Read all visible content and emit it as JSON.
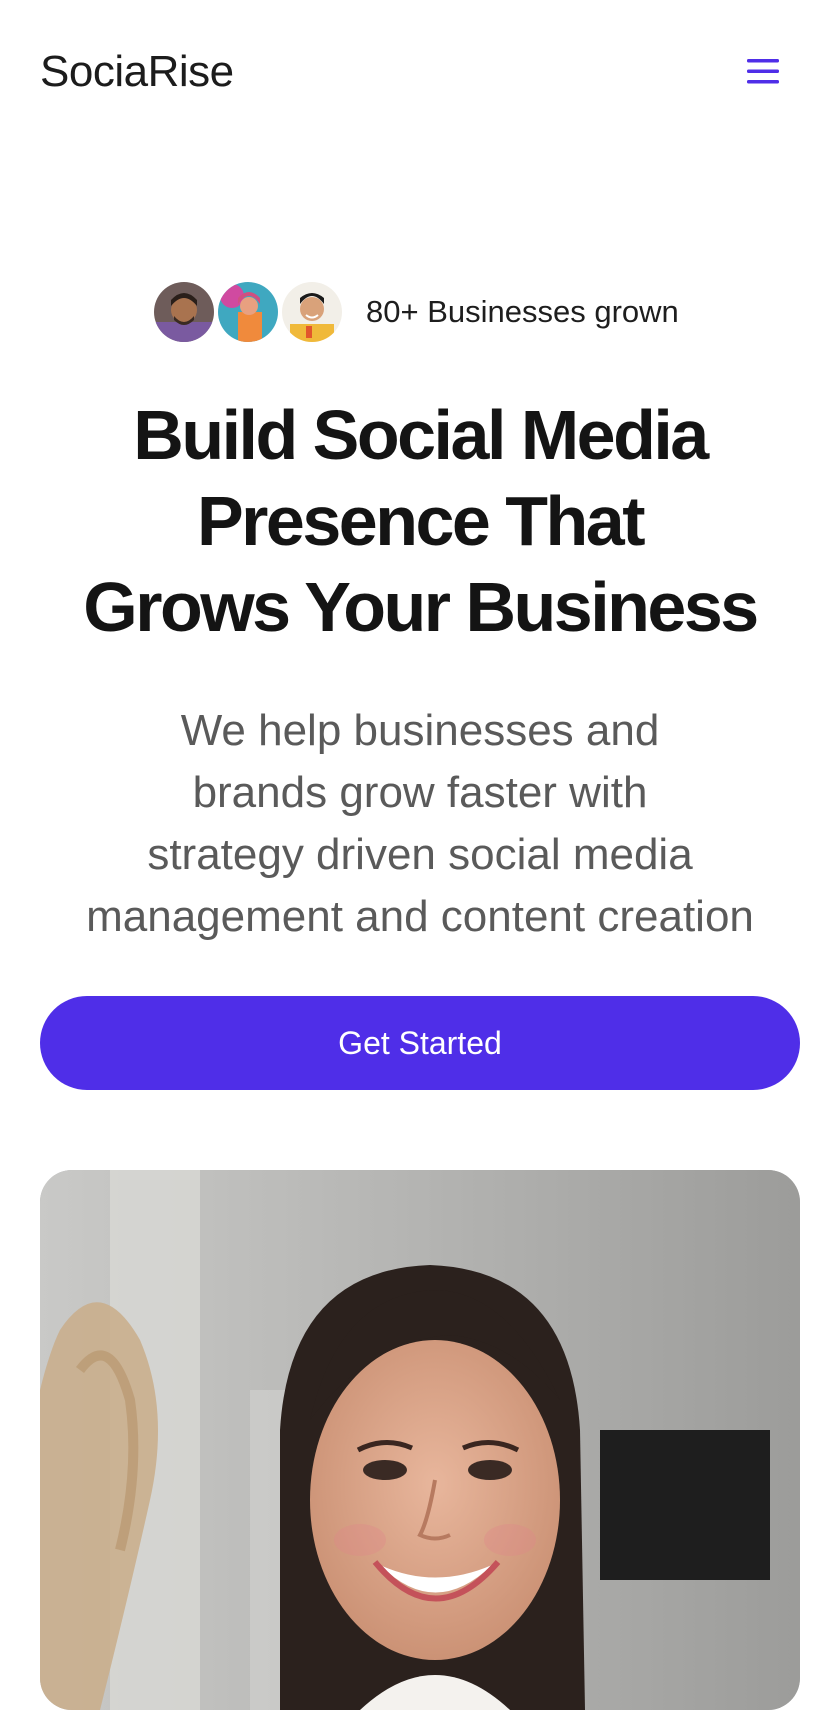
{
  "header": {
    "logo": "SociaRise",
    "menu_icon": "hamburger-menu-icon",
    "accent_color": "#4f2ee8"
  },
  "social_proof": {
    "avatars": [
      "avatar-man-beard",
      "avatar-woman-colorful",
      "avatar-man-smiling"
    ],
    "text": "80+ Businesses grown"
  },
  "hero": {
    "title_lines": [
      "Build Social Media",
      "Presence That",
      "Grows Your Business"
    ],
    "subtitle_lines": [
      "We help businesses and",
      "brands grow faster with",
      "strategy driven social media",
      "management and content creation"
    ],
    "cta_label": "Get Started",
    "cta_color": "#4f2ee8",
    "image": "smiling-woman-photo"
  }
}
